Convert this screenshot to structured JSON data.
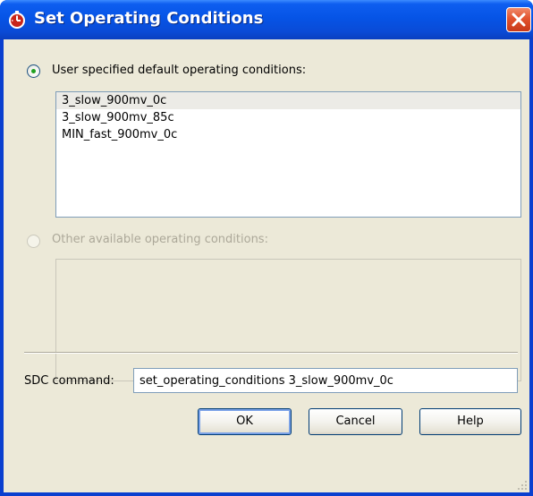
{
  "window": {
    "title": "Set Operating Conditions",
    "icon": "app-stopwatch-icon",
    "close_icon": "close-icon"
  },
  "options": {
    "user_specified": {
      "label": "User specified default operating conditions:",
      "selected": true,
      "enabled": true
    },
    "other_available": {
      "label": "Other available operating conditions:",
      "selected": false,
      "enabled": false
    }
  },
  "user_list": {
    "items": [
      "3_slow_900mv_0c",
      "3_slow_900mv_85c",
      "MIN_fast_900mv_0c"
    ],
    "selected_index": 0
  },
  "other_list": {
    "items": []
  },
  "sdc": {
    "label": "SDC command:",
    "value": "set_operating_conditions 3_slow_900mv_0c"
  },
  "buttons": {
    "ok": "OK",
    "cancel": "Cancel",
    "help": "Help"
  },
  "colors": {
    "title_bar": "#0654e6",
    "close_button": "#e2532e",
    "dialog_background": "#ece9d8",
    "radio_selected_dot": "#21a121"
  }
}
